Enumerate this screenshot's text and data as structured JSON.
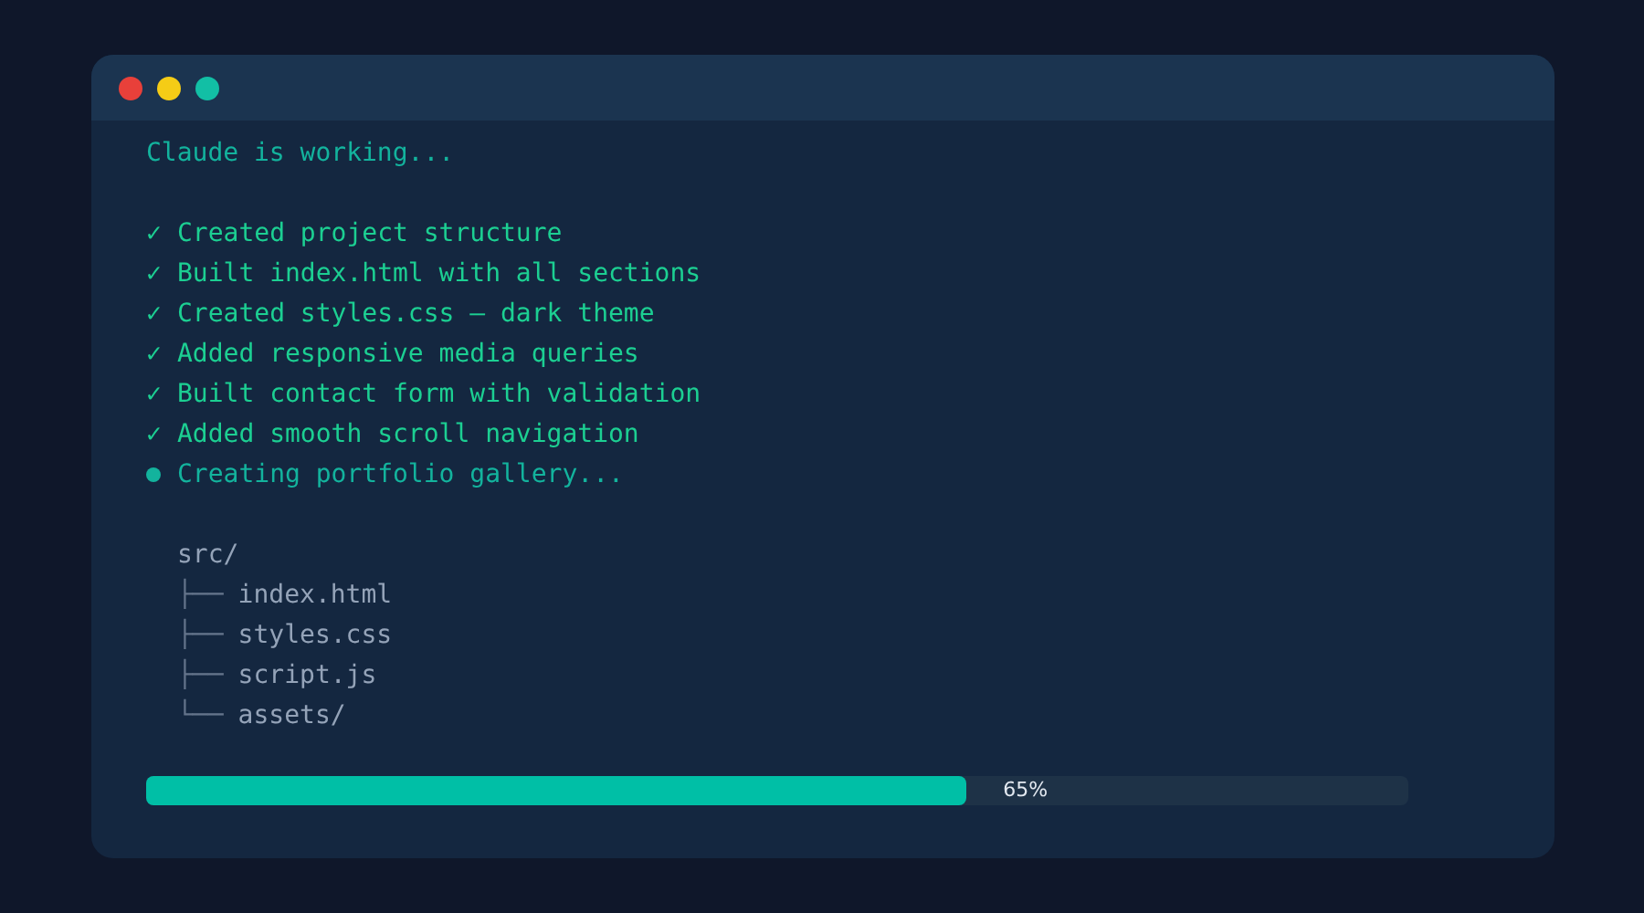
{
  "window": {
    "controls": [
      {
        "color": "#e8403a"
      },
      {
        "color": "#f5cc16"
      },
      {
        "color": "#12bfa5"
      }
    ]
  },
  "heading": "Claude is working...",
  "tasks": [
    {
      "kind": "done",
      "mark": "✓",
      "text": "Created project structure"
    },
    {
      "kind": "done",
      "mark": "✓",
      "text": "Built index.html with all sections"
    },
    {
      "kind": "done",
      "mark": "✓",
      "text": "Created styles.css — dark theme"
    },
    {
      "kind": "done",
      "mark": "✓",
      "text": "Added responsive media queries"
    },
    {
      "kind": "done",
      "mark": "✓",
      "text": "Built contact form with validation"
    },
    {
      "kind": "done",
      "mark": "✓",
      "text": "Added smooth scroll navigation"
    },
    {
      "kind": "active",
      "text": "Creating portfolio gallery..."
    }
  ],
  "file_tree": {
    "name": "src/",
    "children": [
      {
        "branch": "├──",
        "name": "index.html"
      },
      {
        "branch": "├──",
        "name": "styles.css"
      },
      {
        "branch": "├──",
        "name": "script.js"
      },
      {
        "branch": "└──",
        "name": "assets/"
      }
    ]
  },
  "progress": {
    "level": 0.65,
    "reading": "65%"
  }
}
